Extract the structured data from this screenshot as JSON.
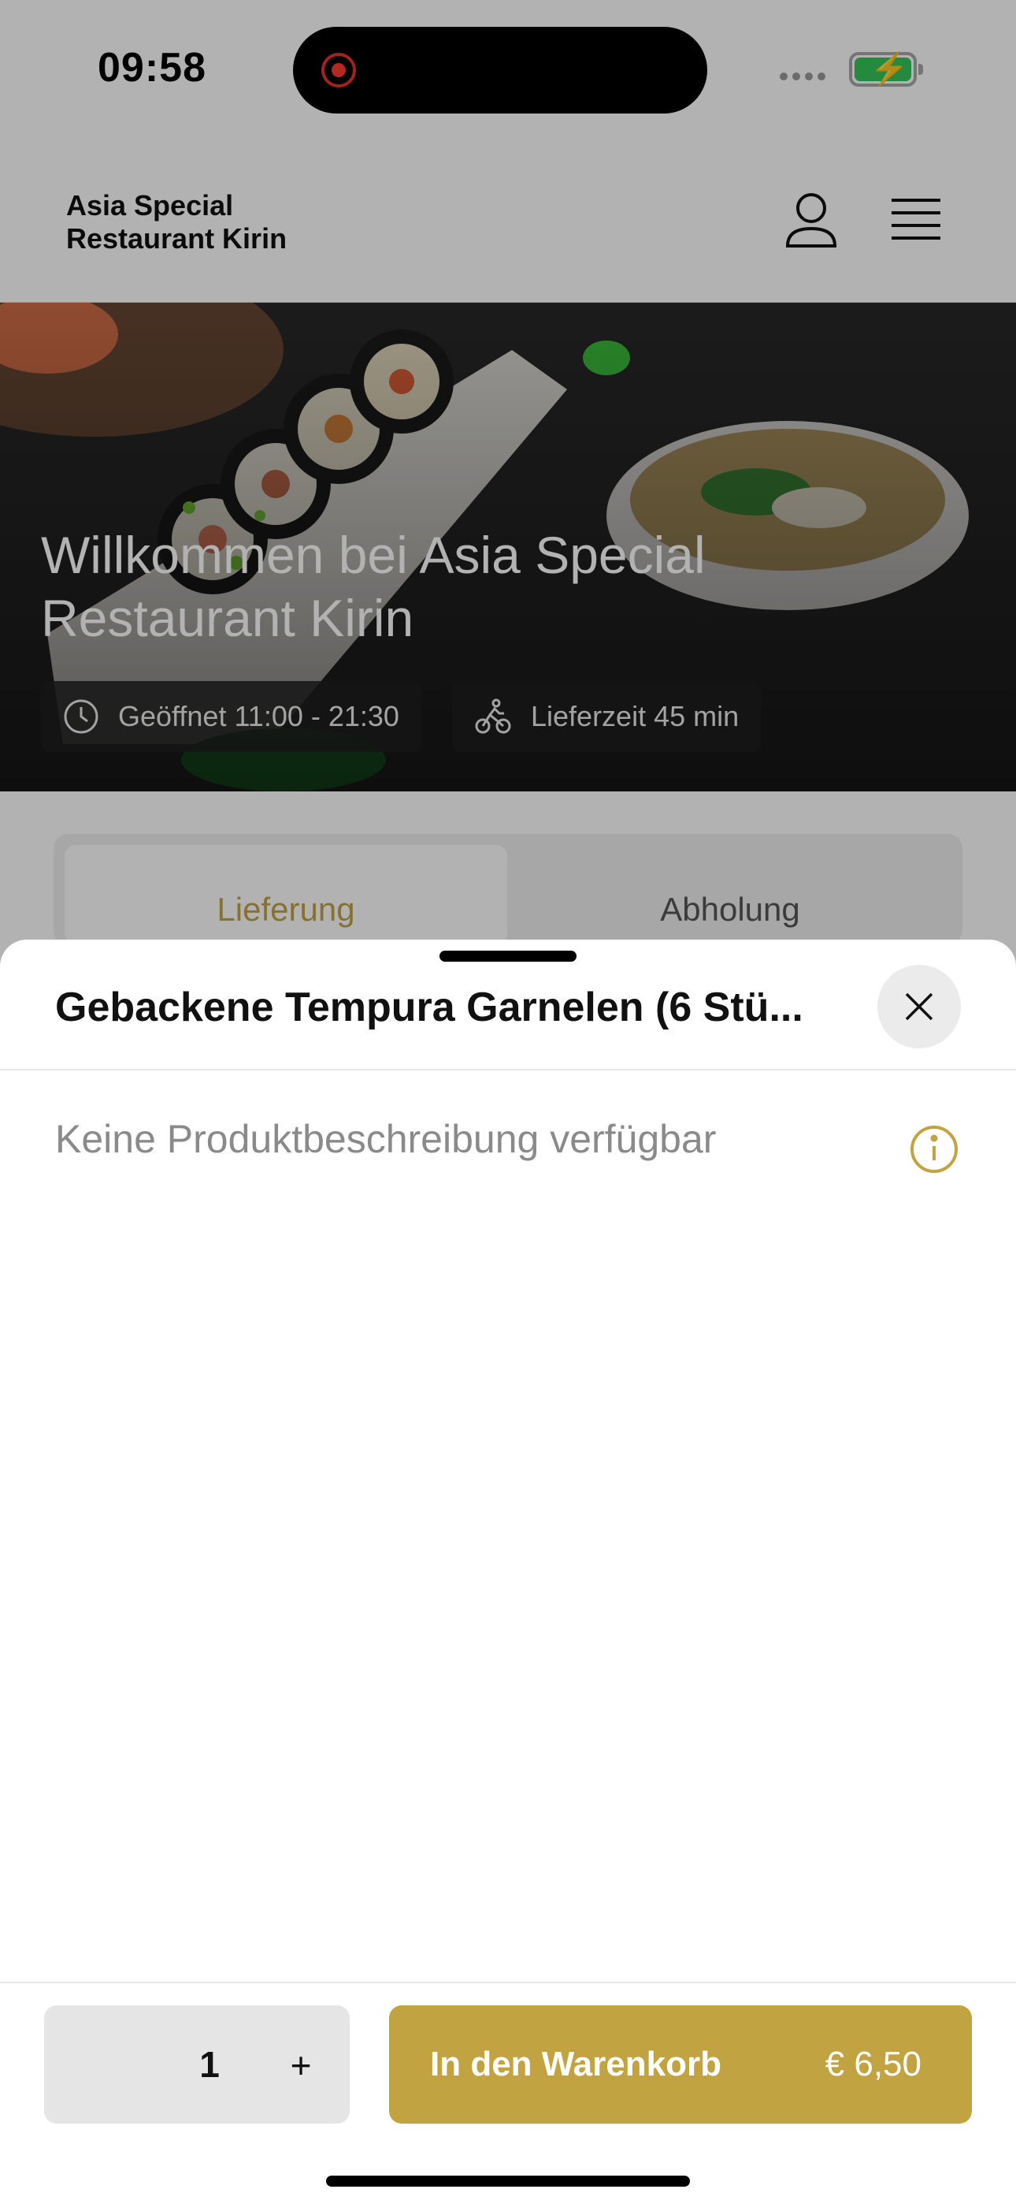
{
  "status_bar": {
    "time": "09:58"
  },
  "header": {
    "brand_line1": "Asia Special",
    "brand_line2": "Restaurant Kirin"
  },
  "hero": {
    "title": "Willkommen bei Asia Special Restaurant Kirin",
    "hours": "Geöffnet 11:00 - 21:30",
    "delivery_time": "Lieferzeit 45 min"
  },
  "order_tabs": {
    "delivery": "Lieferung",
    "pickup": "Abholung",
    "selected": "Lieferung"
  },
  "sheet": {
    "title": "Gebackene Tempura Garnelen (6 Stü...",
    "description": "Keine Produktbeschreibung verfügbar",
    "quantity": "1",
    "plus_label": "+",
    "add_to_cart_label": "In den Warenkorb",
    "price": "€ 6,50"
  },
  "colors": {
    "accent": "#c2a342",
    "overlay": "rgba(0,0,0,0.3)",
    "recording": "#ff3b30",
    "battery": "#34c759"
  },
  "icons": [
    "user-icon",
    "menu-icon",
    "clock-icon",
    "bicycle-icon",
    "close-icon",
    "info-icon"
  ]
}
